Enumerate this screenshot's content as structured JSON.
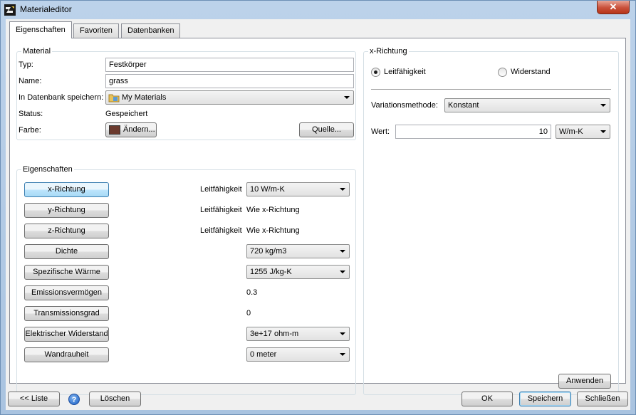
{
  "window": {
    "title": "Materialeditor",
    "close_label": "✕"
  },
  "tabs": [
    {
      "label": "Eigenschaften"
    },
    {
      "label": "Favoriten"
    },
    {
      "label": "Datenbanken"
    }
  ],
  "material": {
    "legend": "Material",
    "typ_label": "Typ:",
    "typ_value": "Festkörper",
    "name_label": "Name:",
    "name_value": "grass",
    "db_label": "In Datenbank speichern:",
    "db_value": "My Materials",
    "status_label": "Status:",
    "status_value": "Gespeichert",
    "farbe_label": "Farbe:",
    "farbe_button": "Ändern...",
    "farbe_color": "#6b3a2e",
    "quelle_button": "Quelle..."
  },
  "eigenschaften": {
    "legend": "Eigenschaften",
    "rows": [
      {
        "button": "x-Richtung",
        "label": "Leitfähigkeit",
        "value": "10 W/m-K"
      },
      {
        "button": "y-Richtung",
        "label": "Leitfähigkeit",
        "value": "Wie x-Richtung"
      },
      {
        "button": "z-Richtung",
        "label": "Leitfähigkeit",
        "value": "Wie x-Richtung"
      },
      {
        "button": "Dichte",
        "label": "",
        "value": "720 kg/m3"
      },
      {
        "button": "Spezifische Wärme",
        "label": "",
        "value": "1255 J/kg-K"
      },
      {
        "button": "Emissionsvermögen",
        "label": "",
        "value": "0.3"
      },
      {
        "button": "Transmissionsgrad",
        "label": "",
        "value": "0"
      },
      {
        "button": "Elektrischer Widerstand",
        "label": "",
        "value": "3e+17 ohm-m"
      },
      {
        "button": "Wandrauheit",
        "label": "",
        "value": "0 meter"
      }
    ]
  },
  "xrichtung": {
    "legend": "x-Richtung",
    "radio_leit": "Leitfähigkeit",
    "radio_wid": "Widerstand",
    "variation_label": "Variationsmethode:",
    "variation_value": "Konstant",
    "wert_label": "Wert:",
    "wert_value": "10",
    "unit_value": "W/m-K",
    "apply_button": "Anwenden"
  },
  "footer": {
    "liste_button": "<< Liste",
    "help_glyph": "?",
    "loeschen_button": "Löschen",
    "ok_button": "OK",
    "speichern_button": "Speichern",
    "schliessen_button": "Schließen"
  }
}
